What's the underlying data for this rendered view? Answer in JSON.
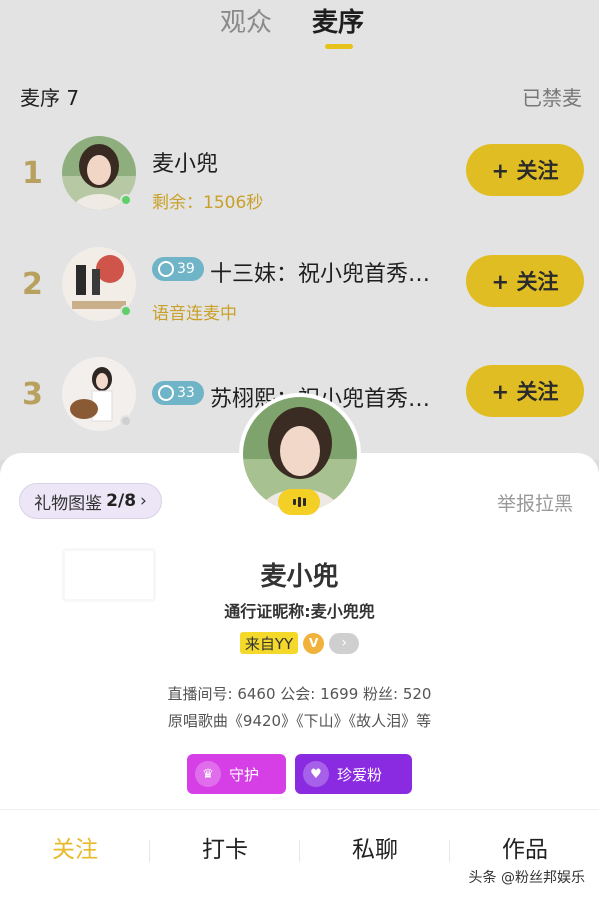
{
  "tabs": [
    "观众",
    "麦序"
  ],
  "queue": {
    "title": "麦序 7",
    "muted_label": "已禁麦",
    "rows": [
      {
        "rank": "1",
        "name": "麦小兜",
        "sub": "剩余：1506秒",
        "badge": "",
        "follow": "+ 关注"
      },
      {
        "rank": "2",
        "name": "十三妹：祝小兜首秀…",
        "sub": "语音连麦中",
        "badge": "39",
        "follow": "+ 关注"
      },
      {
        "rank": "3",
        "name": "苏栩熙：祝小兜首秀…",
        "sub": "",
        "badge": "33",
        "follow": "+ 关注"
      }
    ]
  },
  "sheet": {
    "gift_label": "礼物图鉴",
    "gift_count": "2/8",
    "report": "举报拉黑",
    "name": "麦小兜",
    "pass_name": "通行证昵称:麦小兜兜",
    "from_tag": "来自YY",
    "v_tag": "V",
    "stats": "直播间号: 6460  公会: 1699  粉丝: 520",
    "songs": "原唱歌曲《9420》《下山》《故人泪》等",
    "guard_label": "守护",
    "fan_label": "珍爱粉"
  },
  "actions": [
    "关注",
    "打卡",
    "私聊",
    "作品"
  ],
  "watermark": "头条 @粉丝邦娱乐",
  "colors": {
    "accent": "#e0bd22",
    "guard": "#d63ee6",
    "fan": "#8a2be2",
    "orange_text": "#c9a02a"
  }
}
